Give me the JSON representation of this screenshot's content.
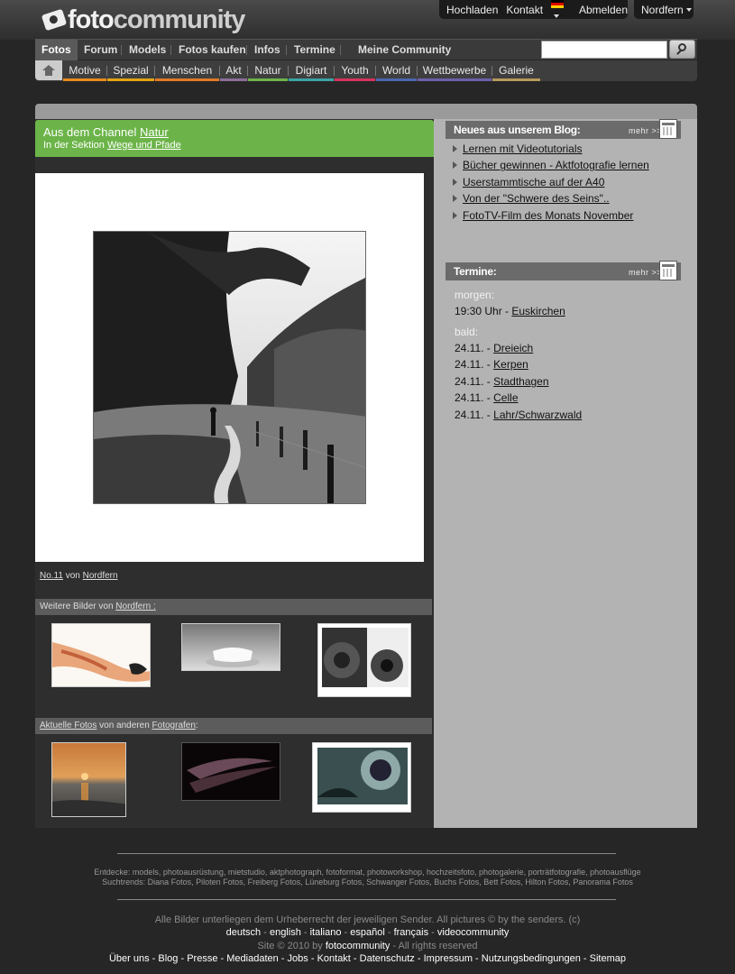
{
  "brand": {
    "logo_part1": "foto",
    "logo_part2": "community"
  },
  "toplinks": {
    "upload": "Hochladen",
    "contact": "Kontakt",
    "logout": "Abmelden"
  },
  "user": {
    "name": "Nordfern"
  },
  "mainnav": {
    "fotos": "Fotos",
    "forum": "Forum",
    "models": "Models",
    "buy": "Fotos kaufen",
    "infos": "Infos",
    "termine": "Termine",
    "community": "Meine Community"
  },
  "search": {
    "value": "",
    "placeholder": ""
  },
  "subnav": [
    {
      "label": "Motive",
      "color": "#e98b1d"
    },
    {
      "label": "Spezial",
      "color": "#e2a313"
    },
    {
      "label": "Menschen",
      "color": "#e07a24"
    },
    {
      "label": "Akt",
      "color": "#8c6e98"
    },
    {
      "label": "Natur",
      "color": "#6cb449"
    },
    {
      "label": "Digiart",
      "color": "#3aa4a4"
    },
    {
      "label": "Youth",
      "color": "#d6335d"
    },
    {
      "label": "World",
      "color": "#4b67b0"
    },
    {
      "label": "Wettbewerbe",
      "color": "#6c5fa8"
    },
    {
      "label": "Galerie",
      "color": "#b59a5a"
    }
  ],
  "channel": {
    "prefix": "Aus dem Channel ",
    "channel_link": "Natur",
    "section_prefix": "In der Sektion ",
    "section_link": "Wege und Pfade",
    "color": "#6cb449"
  },
  "photo": {
    "title": "No.11",
    "by": " von ",
    "author": "Nordfern"
  },
  "more_photos": {
    "prefix": "Weitere Bilder von ",
    "author": "Nordfern :"
  },
  "current_photos": {
    "link1": "Aktuelle Fotos",
    "middle": " von anderen ",
    "link2": "Fotografen",
    "suffix": ":"
  },
  "blog": {
    "title": "Neues aus unserem Blog:",
    "more": "mehr >>",
    "items": [
      "Lernen mit Videotutorials",
      "Bücher gewinnen - Aktfotografie lernen",
      "Userstammtische auf der A40",
      "Von der \"Schwere des Seins\"..",
      "FotoTV-Film des Monats November"
    ]
  },
  "termine": {
    "title": "Termine:",
    "more": "mehr >>",
    "tomorrow_label": "morgen:",
    "tomorrow": [
      {
        "time": "19:30 Uhr - ",
        "place": "Euskirchen"
      }
    ],
    "soon_label": "bald:",
    "soon": [
      {
        "date": "24.11. - ",
        "place": "Dreieich"
      },
      {
        "date": "24.11. - ",
        "place": "Kerpen"
      },
      {
        "date": "24.11. - ",
        "place": "Stadthagen"
      },
      {
        "date": "24.11. - ",
        "place": "Celle"
      },
      {
        "date": "24.11. - ",
        "place": "Lahr/Schwarzwald"
      }
    ]
  },
  "footer": {
    "discover": "Entdecke: models, photoausrüstung, mietstudio, aktphotograph, fotoformat, photoworkshop, hochzeitsfoto, photogalerie, porträtfotografie, photoausflüge",
    "trends": "Suchtrends: Diana Fotos, Piloten Fotos, Freiberg Fotos, Lüneburg Fotos, Schwanger Fotos, Buchs Fotos, Bett Fotos, Hilton Fotos, Panorama Fotos",
    "copyright_note": "Alle Bilder unterliegen dem Urheberrecht der jeweiligen Sender. All pictures © by the senders. (c)",
    "languages": [
      "deutsch",
      "english",
      "italiano",
      "español",
      "français",
      "videocommunity"
    ],
    "site_prefix": "Site © 2010 by ",
    "site_brand": "fotocommunity",
    "site_suffix": " - All rights reserved",
    "links": [
      "Über uns",
      "Blog",
      "Presse",
      "Mediadaten",
      "Jobs",
      "Kontakt",
      "Datenschutz",
      "Impressum",
      "Nutzungsbedingungen",
      "Sitemap"
    ]
  }
}
